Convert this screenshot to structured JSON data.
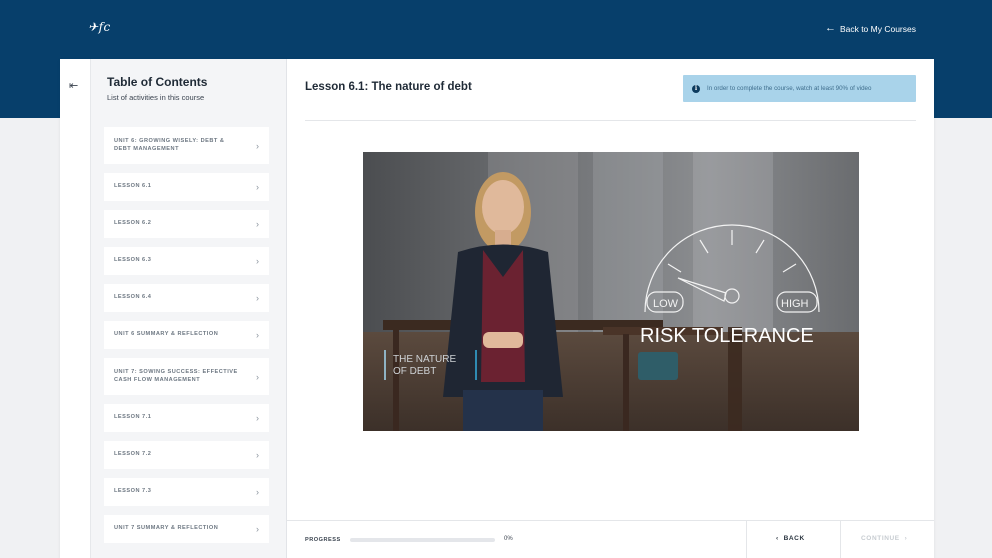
{
  "header": {
    "logo_text": "fc",
    "back_link": "Back to My Courses",
    "back_arrow_icon": "arrow-left-icon",
    "bg_color": "#073f6b"
  },
  "sidebar": {
    "collapse_icon": "collapse-left-icon",
    "title": "Table of Contents",
    "subtitle": "List of activities in this course",
    "items": [
      {
        "label": "UNIT 6: GROWING WISELY: DEBT & DEBT MANAGEMENT",
        "lines": 2
      },
      {
        "label": "LESSON 6.1",
        "lines": 1
      },
      {
        "label": "LESSON 6.2",
        "lines": 1
      },
      {
        "label": "LESSON 6.3",
        "lines": 1
      },
      {
        "label": "LESSON 6.4",
        "lines": 1
      },
      {
        "label": "UNIT 6 SUMMARY & REFLECTION",
        "lines": 1
      },
      {
        "label": "UNIT 7: SOWING SUCCESS: EFFECTIVE CASH FLOW MANAGEMENT",
        "lines": 2
      },
      {
        "label": "LESSON 7.1",
        "lines": 1
      },
      {
        "label": "LESSON 7.2",
        "lines": 1
      },
      {
        "label": "LESSON 7.3",
        "lines": 1
      },
      {
        "label": "UNIT 7 SUMMARY & REFLECTION",
        "lines": 1
      }
    ]
  },
  "main": {
    "lesson_title": "Lesson 6.1: The nature of debt",
    "notice": "In order to complete the course, watch at least 90% of video",
    "video": {
      "overlay_title": "THE NATURE OF DEBT",
      "gauge_low": "LOW",
      "gauge_high": "HIGH",
      "gauge_caption": "RISK TOLERANCE"
    }
  },
  "footer": {
    "progress_label": "PROGRESS",
    "progress_value": 0,
    "progress_text": "0%",
    "back_label": "BACK",
    "continue_label": "CONTINUE",
    "accent": "#0d5e8e"
  }
}
